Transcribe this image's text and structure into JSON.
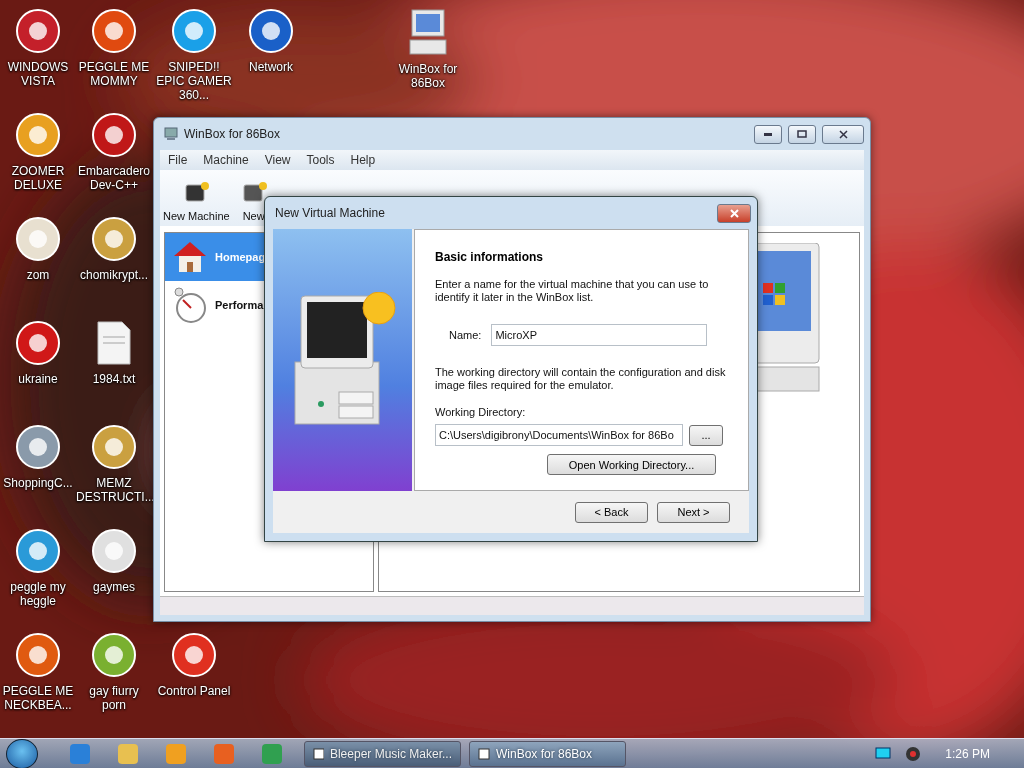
{
  "desktop_icons": [
    {
      "label": "WINDOWS VISTA"
    },
    {
      "label": "ZOOMER DELUXE"
    },
    {
      "label": "zom"
    },
    {
      "label": "ukraine"
    },
    {
      "label": "ShoppingC..."
    },
    {
      "label": "peggle my heggle"
    },
    {
      "label": "PEGGLE ME NECKBEA..."
    },
    {
      "label": "PEGGLE ME MOMMY"
    },
    {
      "label": "Embarcadero Dev-C++"
    },
    {
      "label": "chomikrypt..."
    },
    {
      "label": "1984.txt"
    },
    {
      "label": "MEMZ DESTRUCTI..."
    },
    {
      "label": "gaymes"
    },
    {
      "label": "gay fiurry porn"
    },
    {
      "label": "SNIPED!! EPIC GAMER 360..."
    },
    {
      "label": "Control Panel"
    },
    {
      "label": "Network"
    },
    {
      "label": "WinBox for 86Box"
    }
  ],
  "main_window": {
    "title": "WinBox for 86Box",
    "menu": [
      "File",
      "Machine",
      "View",
      "Tools",
      "Help"
    ],
    "toolbar": [
      {
        "label": "New Machine"
      },
      {
        "label": "New"
      }
    ],
    "sidebar": [
      {
        "label": "Homepag",
        "selected": true
      },
      {
        "label": "Performa",
        "selected": false
      }
    ]
  },
  "dialog": {
    "title": "New Virtual Machine",
    "heading": "Basic informations",
    "intro": "Enter a name for the virtual machine that you can use to identify it later in the WinBox list.",
    "name_label": "Name:",
    "name_value": "MicroXP",
    "dir_text": "The working directory will contain the configuration and disk image files required for the emulator.",
    "dir_label": "Working Directory:",
    "dir_value": "C:\\Users\\digibrony\\Documents\\WinBox for 86Bo",
    "browse": "...",
    "open_dir": "Open Working Directory...",
    "back": "< Back",
    "next": "Next >"
  },
  "taskbar": {
    "tasks": [
      {
        "label": "Bleeper Music Maker...",
        "selected": false
      },
      {
        "label": "WinBox for 86Box",
        "selected": true
      }
    ],
    "clock": "1:26 PM"
  }
}
